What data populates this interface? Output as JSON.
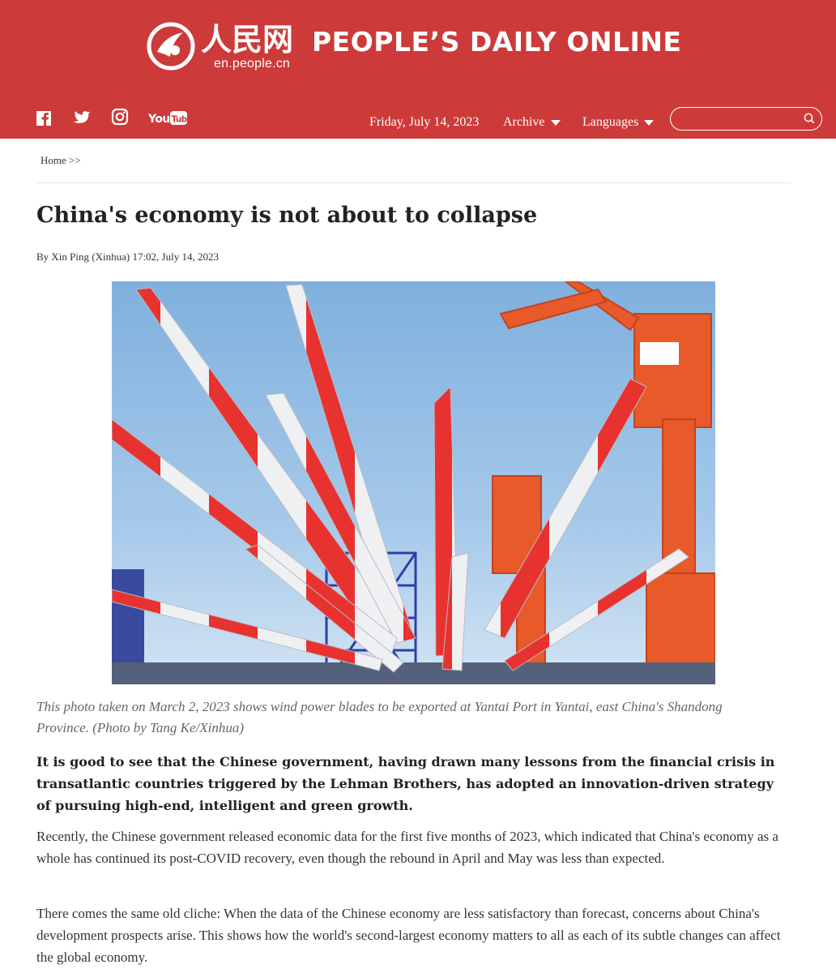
{
  "header": {
    "logo_cn": "人民网",
    "logo_url": "en.people.cn",
    "site_name": "PEOPLE’S DAILY ONLINE",
    "social": [
      "facebook-icon",
      "twitter-icon",
      "instagram-icon",
      "youtube-icon"
    ],
    "youtube_label": "YouTube",
    "date": "Friday, July 14, 2023",
    "nav": {
      "archive": "Archive",
      "languages": "Languages"
    },
    "search": {
      "placeholder": ""
    },
    "brand_color": "#cd3a3a"
  },
  "breadcrumb": "Home >>",
  "article": {
    "title": "China's economy is not about to collapse",
    "byline": "By Xin Ping (Xinhua) 17:02, July 14, 2023",
    "caption": "This photo taken on March 2, 2023 shows wind power blades to be exported at Yantai Port in Yantai, east China's Shandong Province. (Photo by Tang Ke/Xinhua)",
    "lead": "It is good to see that the Chinese government, having drawn many lessons from the financial crisis in transatlantic countries triggered by the Lehman Brothers, has adopted an innovation-driven strategy of pursuing high-end, intelligent and green growth.",
    "paragraphs": [
      "Recently, the Chinese government released economic data for the first five months of 2023, which indicated that China's economy as a whole has continued its post-COVID recovery, even though the rebound in April and May was less than expected.",
      "There comes the same old cliche: When the data of the Chinese economy are less satisfactory than forecast, concerns about China's development prospects arise. This shows how the world's second-largest economy matters to all as each of its subtle changes can affect the global economy."
    ]
  }
}
